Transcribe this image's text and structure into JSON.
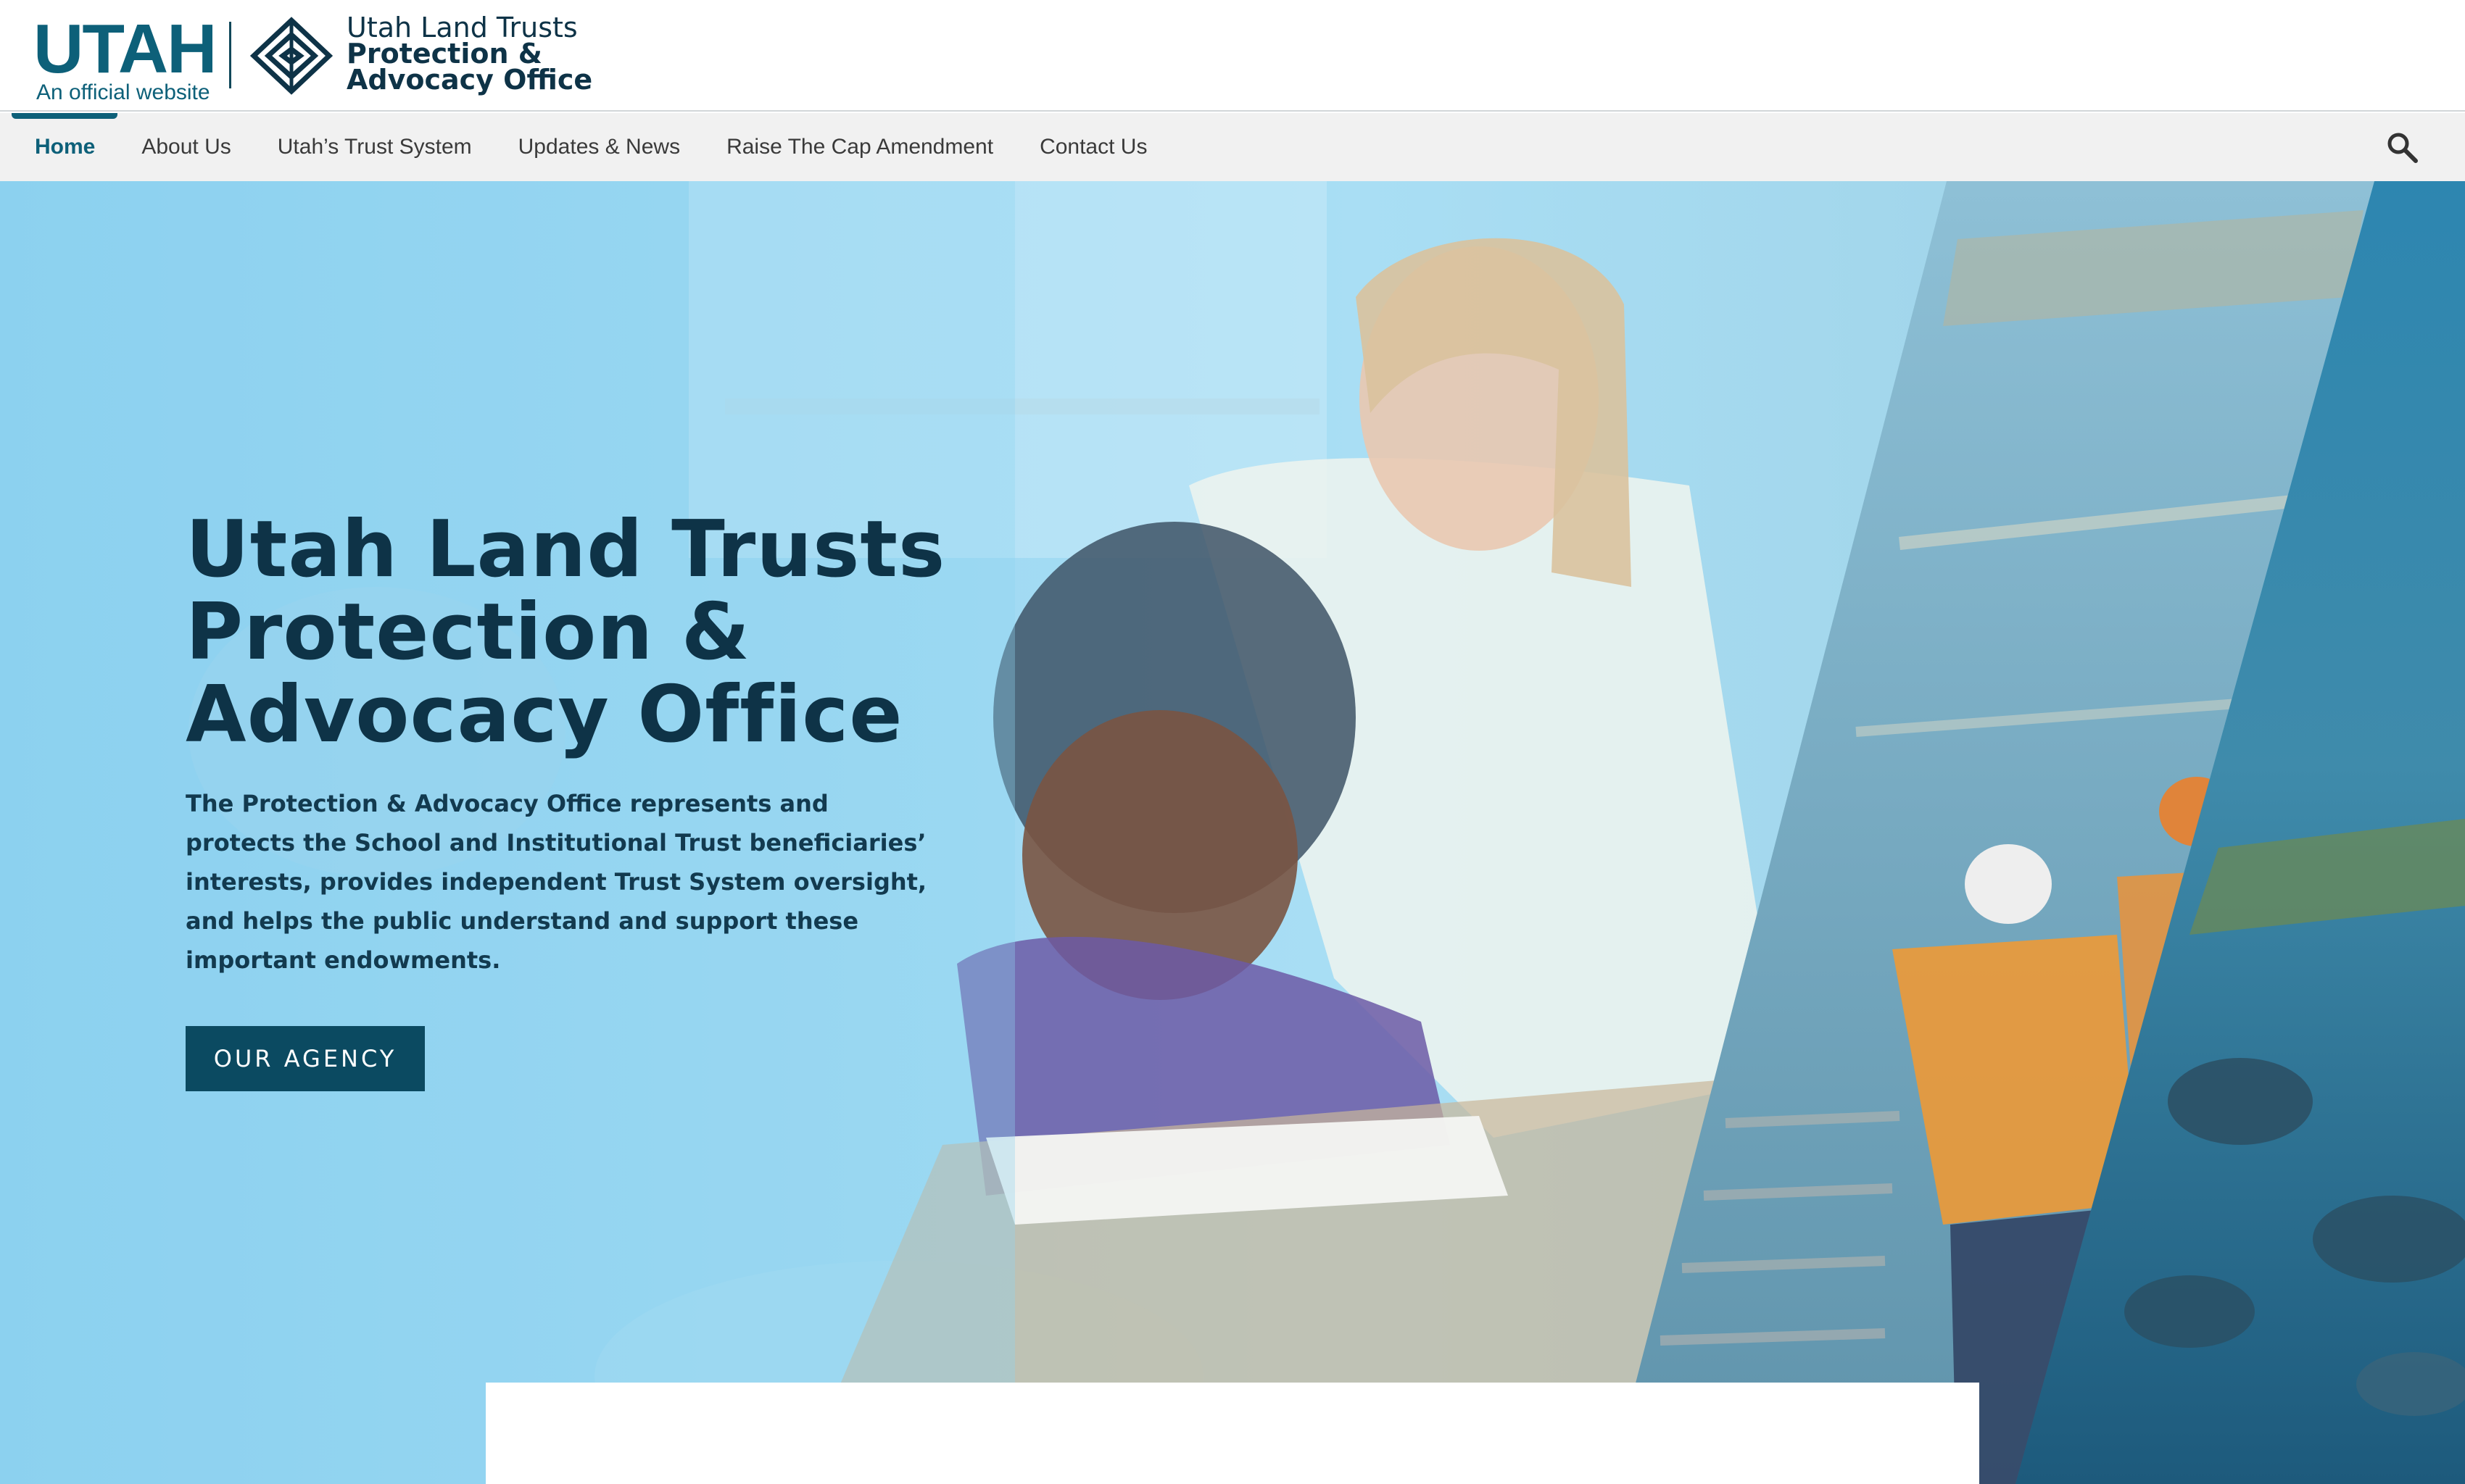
{
  "header": {
    "state_wordmark": "UTAH",
    "official_site": "An official website",
    "agency_name": [
      "Utah Land Trusts",
      "Protection &",
      "Advocacy Office"
    ]
  },
  "nav": {
    "items": [
      {
        "label": "Home",
        "active": true
      },
      {
        "label": "About Us"
      },
      {
        "label": "Utah’s Trust System"
      },
      {
        "label": "Updates & News"
      },
      {
        "label": "Raise The Cap Amendment"
      },
      {
        "label": "Contact Us"
      }
    ],
    "search_icon": "search-icon"
  },
  "hero": {
    "title_lines": [
      "Utah Land Trusts",
      "Protection &",
      "Advocacy Office"
    ],
    "description_lines": [
      "The Protection & Advocacy Office represents and",
      "protects the School and Institutional Trust beneficiaries’",
      "interests, provides independent Trust System oversight,",
      "and helps the public understand and support these",
      "important endowments."
    ],
    "cta_label": "OUR AGENCY"
  },
  "colors": {
    "brand_teal": "#0d6079",
    "navy_text": "#0e3347",
    "cta_background": "#0b4a61",
    "nav_background": "#f1f1f1",
    "hero_overlay": "#8fd3f0"
  }
}
